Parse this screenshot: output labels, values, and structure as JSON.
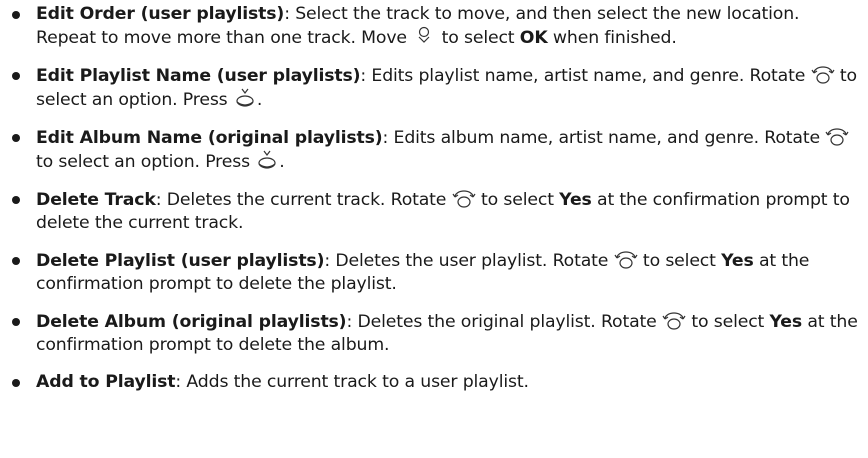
{
  "items": [
    {
      "term": "Edit Order (user playlists)",
      "t1": ": Select the track to move, and then select the new location. Repeat to move more than one track. Move ",
      "icon1": "joystick-down-icon",
      "t2": " to select ",
      "b1": "OK",
      "t3": " when finished."
    },
    {
      "term": "Edit Playlist Name (user playlists)",
      "t1": ": Edits playlist name, artist name, and genre. Rotate ",
      "icon1": "rotate-knob-icon",
      "t2": " to select an option. Press ",
      "icon2": "press-knob-icon",
      "t3": "."
    },
    {
      "term": "Edit Album Name (original playlists)",
      "t1": ": Edits album name, artist name, and genre. Rotate ",
      "icon1": "rotate-knob-icon",
      "t2": " to select an option. Press ",
      "icon2": "press-knob-icon",
      "t3": "."
    },
    {
      "term": "Delete Track",
      "t1": ": Deletes the current track. Rotate ",
      "icon1": "rotate-knob-icon",
      "t2": " to select ",
      "b1": "Yes",
      "t3": " at the confirmation prompt to delete the current track."
    },
    {
      "term": "Delete Playlist (user playlists)",
      "t1": ": Deletes the user playlist. Rotate ",
      "icon1": "rotate-knob-icon",
      "t2": " to select ",
      "b1": "Yes",
      "t3": " at the confirmation prompt to delete the playlist."
    },
    {
      "term": "Delete Album (original playlists)",
      "t1": ": Deletes the original playlist. Rotate ",
      "icon1": "rotate-knob-icon",
      "t2": " to select ",
      "b1": "Yes",
      "t3": " at the confirmation prompt to delete the album."
    },
    {
      "term": "Add to Playlist",
      "t1": ": Adds the current track to a user playlist."
    }
  ]
}
